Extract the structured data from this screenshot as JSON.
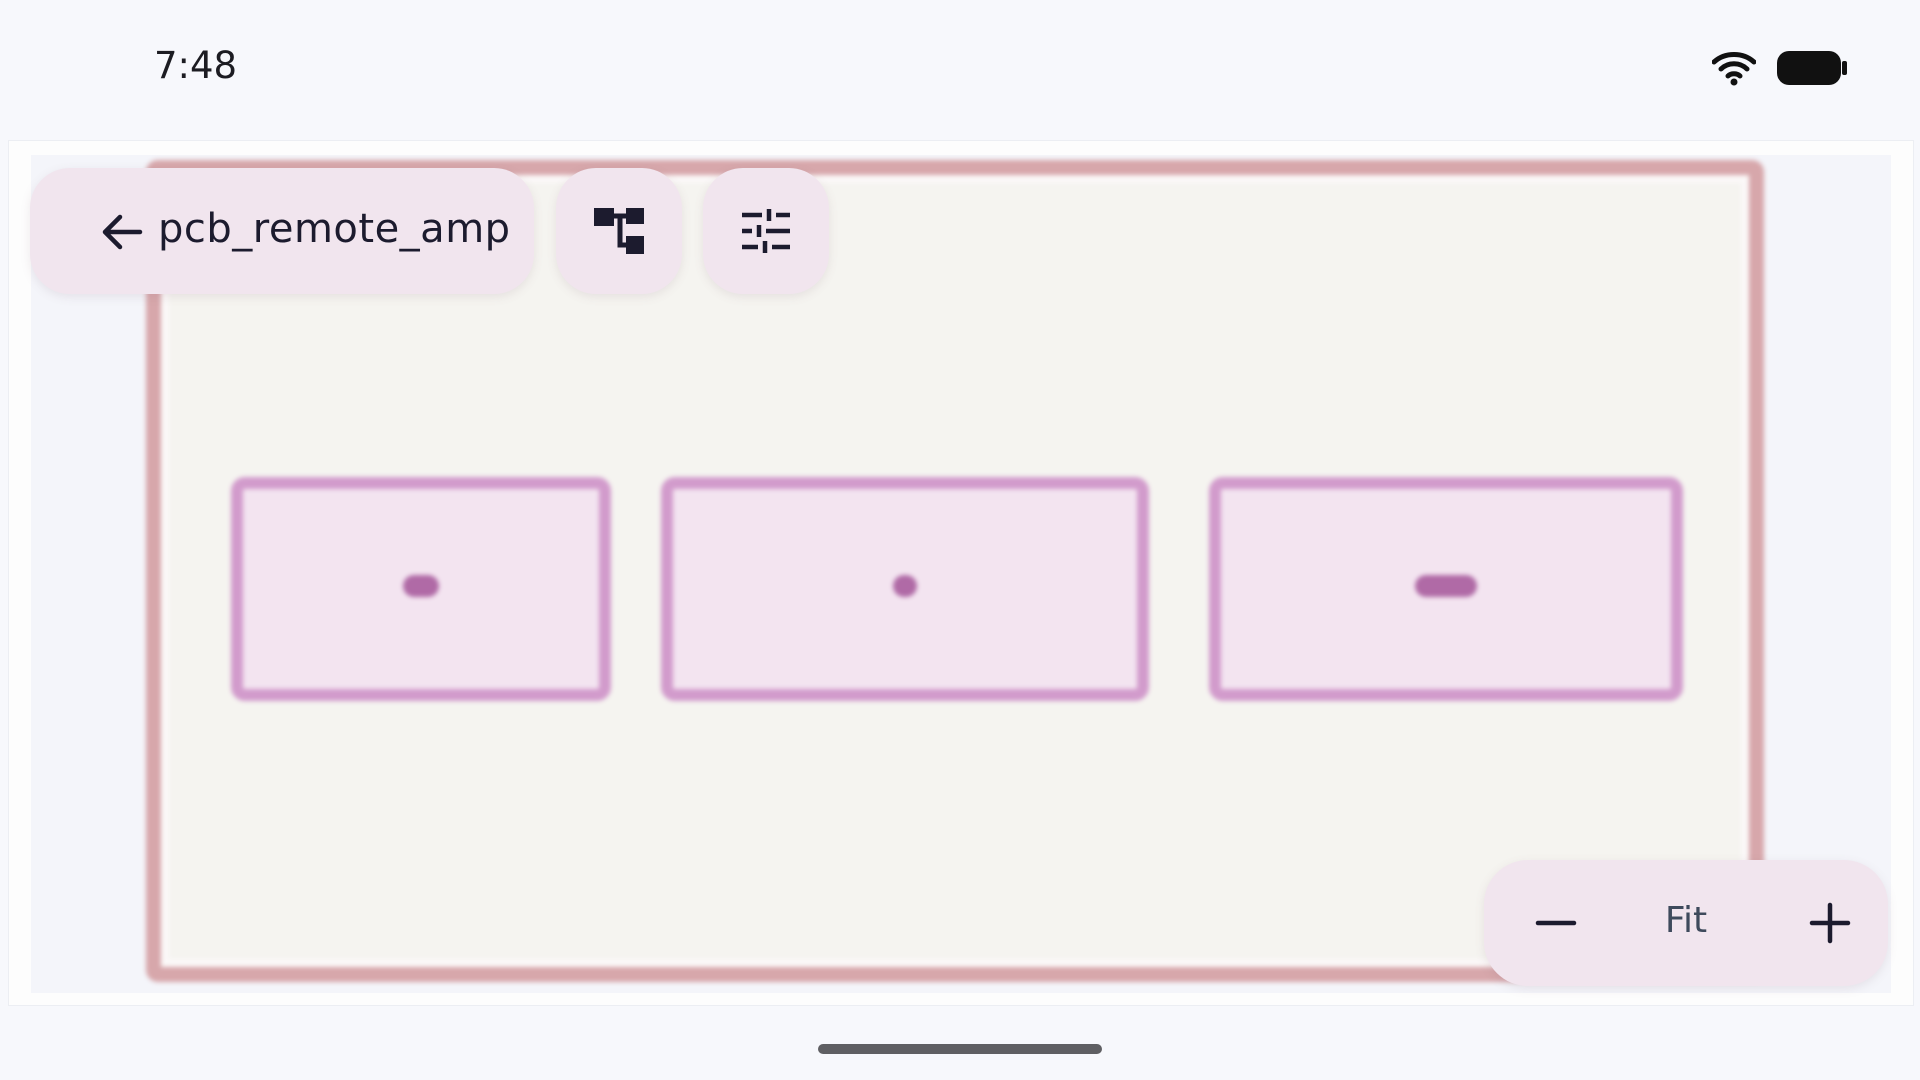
{
  "status_bar": {
    "time": "7:48",
    "icons": [
      "wifi-icon",
      "battery-icon"
    ]
  },
  "toolbar": {
    "title": "pcb_remote_amp",
    "back_icon": "arrow-back-icon",
    "hierarchy_icon": "hierarchy-tree-icon",
    "settings_icon": "tune-sliders-icon"
  },
  "canvas": {
    "board_outline_color": "#d7a7ab",
    "component_border_color": "#d29bcc",
    "component_fill_color": "#f3e4f0"
  },
  "zoom": {
    "level_label": "Fit",
    "zoom_out_icon": "minus-icon",
    "zoom_in_icon": "plus-icon"
  },
  "colors": {
    "pill_background": "#f1e5ee",
    "app_background": "#f7f8fc",
    "text_primary": "#1c1b2e"
  }
}
